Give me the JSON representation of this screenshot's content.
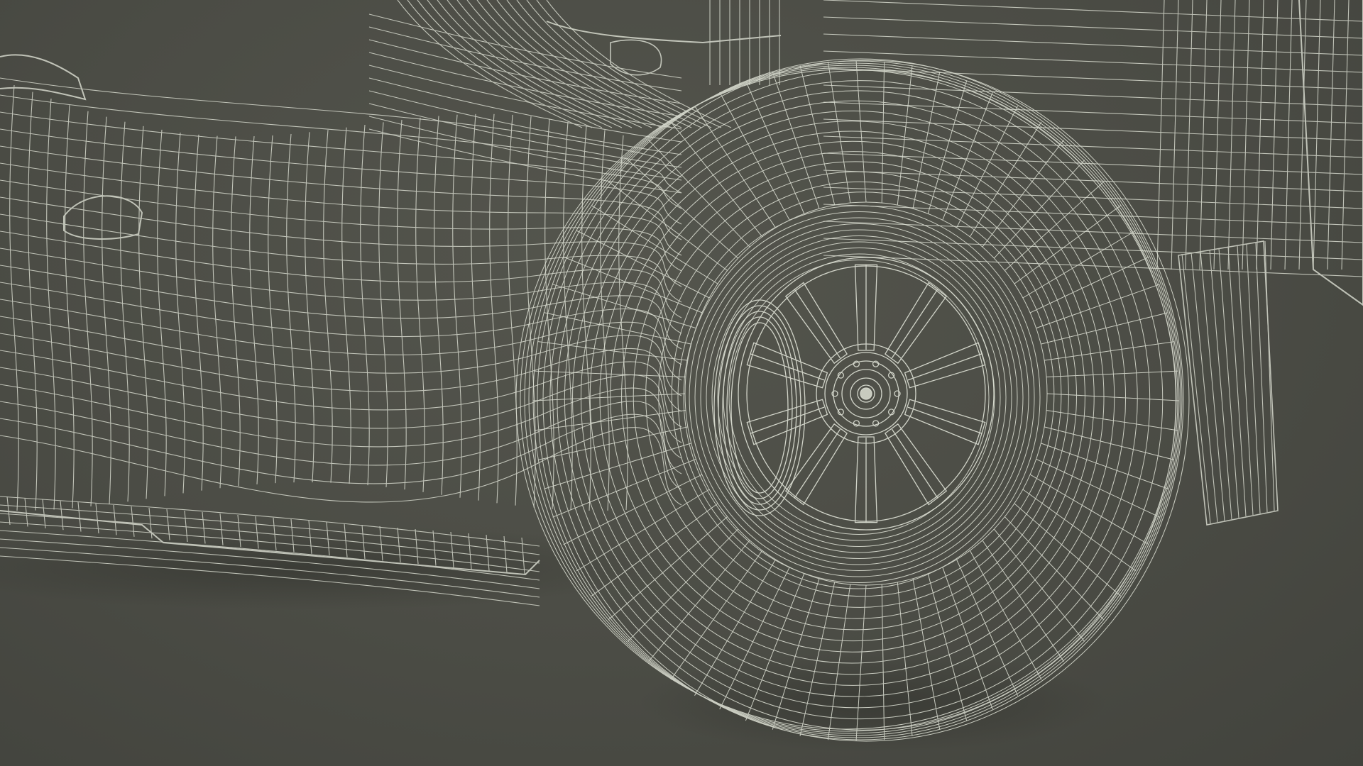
{
  "scene": {
    "subject": "wireframe-race-car-rear-wheel",
    "render_mode": "wireframe",
    "colors": {
      "background": "#4b4c45",
      "wire": "#d9dcd0",
      "shadow": "#3a3b35"
    }
  }
}
